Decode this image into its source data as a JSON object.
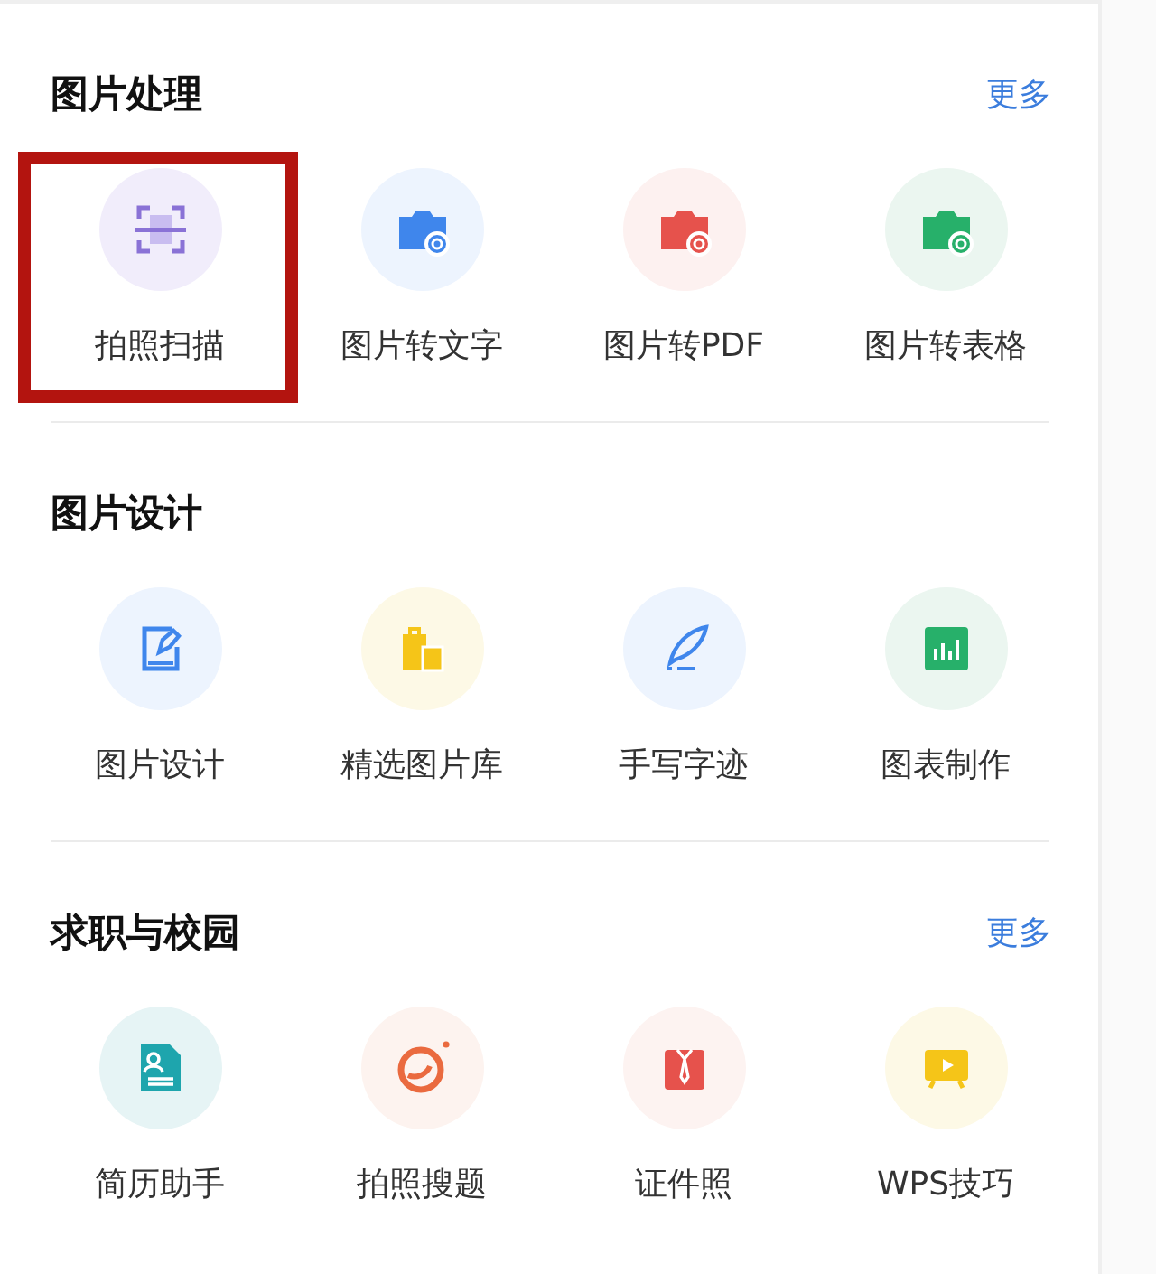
{
  "sections": [
    {
      "title": "图片处理",
      "more": "更多",
      "items": [
        {
          "label": "拍照扫描",
          "highlighted": true,
          "color": "#f1edfb"
        },
        {
          "label": "图片转文字",
          "highlighted": false,
          "color": "#edf4fe"
        },
        {
          "label": "图片转PDF",
          "highlighted": false,
          "color": "#fdf1f0"
        },
        {
          "label": "图片转表格",
          "highlighted": false,
          "color": "#ebf6f0"
        }
      ]
    },
    {
      "title": "图片设计",
      "items": [
        {
          "label": "图片设计",
          "highlighted": false,
          "color": "#edf4fe"
        },
        {
          "label": "精选图片库",
          "highlighted": false,
          "color": "#fdf9e6"
        },
        {
          "label": "手写字迹",
          "highlighted": false,
          "color": "#edf4fe"
        },
        {
          "label": "图表制作",
          "highlighted": false,
          "color": "#ebf6f0"
        }
      ]
    },
    {
      "title": "求职与校园",
      "more": "更多",
      "items": [
        {
          "label": "简历助手",
          "highlighted": false,
          "color": "#e6f4f5"
        },
        {
          "label": "拍照搜题",
          "highlighted": false,
          "color": "#fdf3ef"
        },
        {
          "label": "证件照",
          "highlighted": false,
          "color": "#fdf3f1"
        },
        {
          "label": "WPS技巧",
          "highlighted": false,
          "color": "#fdf9e6"
        }
      ]
    }
  ]
}
